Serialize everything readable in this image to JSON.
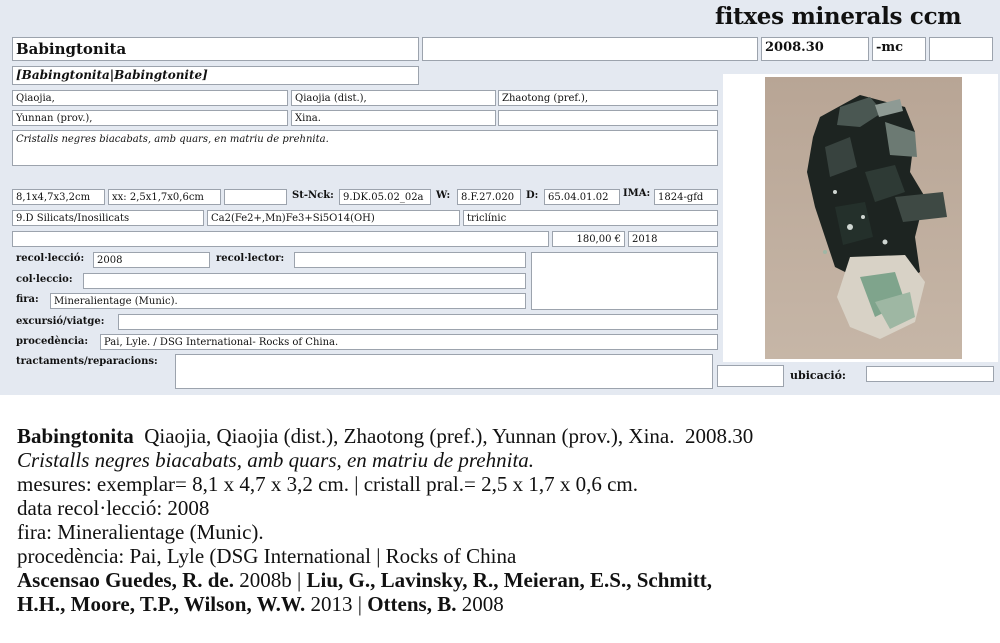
{
  "brand": "fitxes minerals ccm",
  "card": {
    "name": "Babingtonita",
    "catalog_number": "2008.30",
    "suffix": "-mc",
    "synonym": "[Babingtonita|Babingtonite]",
    "locality": {
      "place": "Qiaojia,",
      "district": "Qiaojia (dist.),",
      "prefecture": "Zhaotong (pref.),",
      "province": "Yunnan (prov.),",
      "country": "Xina."
    },
    "description": "Cristalls negres biacabats, amb quars, en matriu de prehnita.",
    "size_specimen": "8,1x4,7x3,2cm",
    "size_crystal": "xx: 2,5x1,7x0,6cm",
    "strunz_label": "St-Nck:",
    "strunz_value": "9.DK.05.02_02a",
    "w_label": "W:",
    "w_value": "8.F.27.020",
    "d_label": "D:",
    "d_value": "65.04.01.02",
    "ima_label": "IMA:",
    "ima_value": "1824-gfd",
    "class": "9.D Silicats/Inosilicats",
    "formula": "Ca2(Fe2+,Mn)Fe3+Si5O14(OH)",
    "system": "triclínic",
    "price": "180,00 €",
    "year": "2018",
    "recollection_label": "recol·lecció:",
    "recollection_value": "2008",
    "collector_label": "recol·lector:",
    "collection_label": "col·leccio:",
    "fair_label": "fira:",
    "fair_value": "Mineralientage (Munic).",
    "trip_label": "excursió/viatge:",
    "provenance_label": "procedència:",
    "provenance_value": "Pai, Lyle. / DSG International- Rocks of China.",
    "treatments_label": "tractaments/reparacions:",
    "location_label": "ubicació:"
  },
  "summary": {
    "name": "Babingtonita",
    "locality": "Qiaojia, Qiaojia (dist.), Zhaotong (pref.), Yunnan (prov.), Xina.",
    "number": "2008.30",
    "description": "Cristalls negres biacabats, amb quars, en matriu de prehnita.",
    "measures": "mesures: exemplar= 8,1 x 4,7 x 3,2 cm. | cristall pral.= 2,5 x 1,7 x 0,6 cm.",
    "collection_date": "data recol·lecció: 2008",
    "fair": "fira: Mineralientage (Munic).",
    "provenance": "procedència: Pai, Lyle (DSG International | Rocks of China",
    "ref1_authors": "Ascensao Guedes, R. de.",
    "ref1_year": "2008b |",
    "ref2_authors_a": "Liu, G., Lavinsky, R., Meieran, E.S., Schmitt,",
    "ref2_authors_b": "H.H., Moore, T.P., Wilson, W.W.",
    "ref2_year": "2013 |",
    "ref3_authors": "Ottens, B.",
    "ref3_year": "2008"
  }
}
